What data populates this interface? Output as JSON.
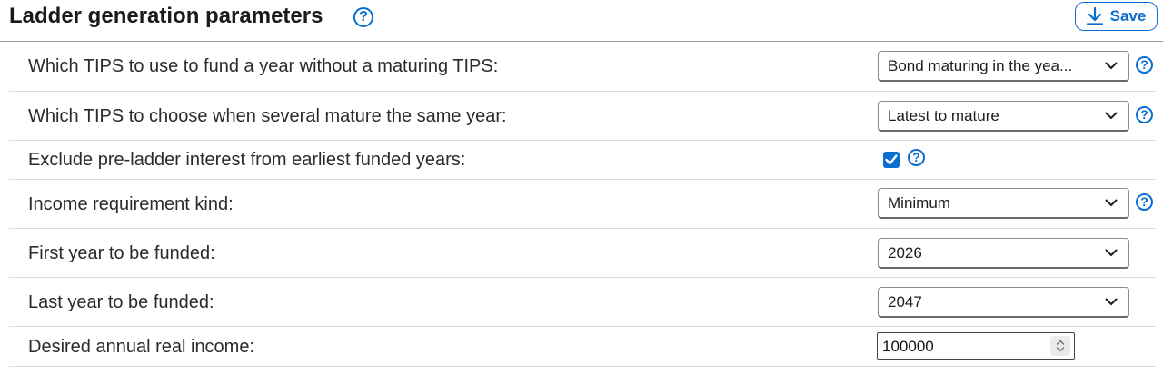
{
  "header": {
    "title": "Ladder generation parameters",
    "help_glyph": "?",
    "save_label": "Save"
  },
  "rows": [
    {
      "label": "Which TIPS to use to fund a year without a maturing TIPS:",
      "control": "select",
      "value": "Bond maturing in the yea...",
      "help": true
    },
    {
      "label": "Which TIPS to choose when several mature the same year:",
      "control": "select",
      "value": "Latest to mature",
      "help": true
    },
    {
      "label": "Exclude pre-ladder interest from earliest funded years:",
      "control": "checkbox",
      "checked": true,
      "help": true
    },
    {
      "label": "Income requirement kind:",
      "control": "select",
      "value": "Minimum",
      "help": true
    },
    {
      "label": "First year to be funded:",
      "control": "select",
      "value": "2026",
      "help": false
    },
    {
      "label": "Last year to be funded:",
      "control": "select",
      "value": "2047",
      "help": false
    },
    {
      "label": "Desired annual real income:",
      "control": "number",
      "value": "100000",
      "help": false
    }
  ],
  "icons": {
    "help": "help-circle-icon",
    "save": "download-icon",
    "dropdown": "chevron-down-icon",
    "checkbox": "checkmark-icon",
    "spinner": "up-down-spinner-icon"
  },
  "colors": {
    "accent": "#0a6ed1",
    "text": "#1d1d1d",
    "divider": "#dcdcdc"
  }
}
